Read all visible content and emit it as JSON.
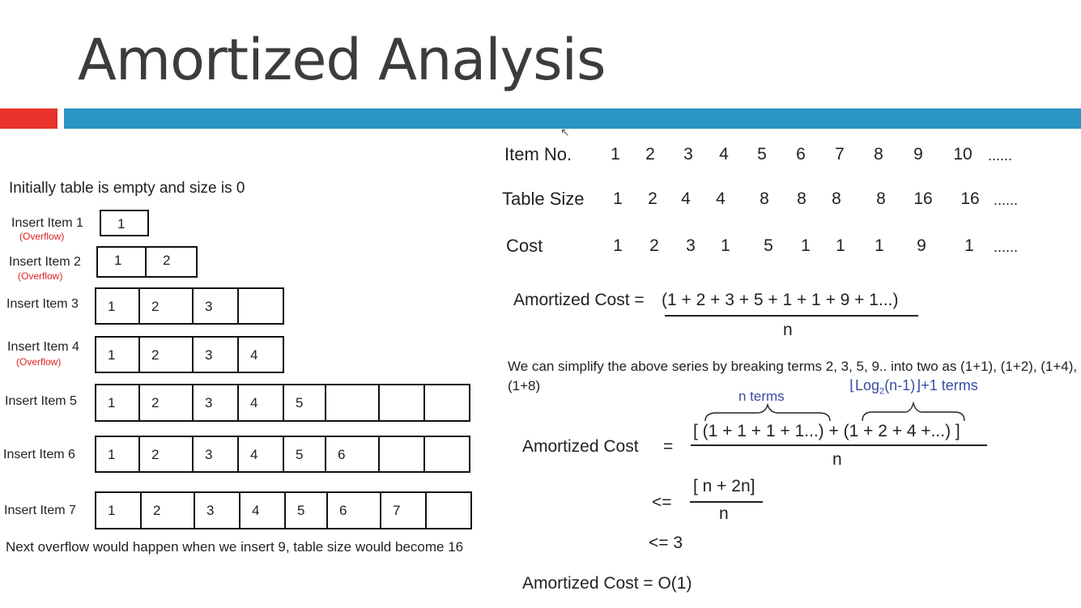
{
  "slide": {
    "title": "Amortized Analysis",
    "accent_red": "#e8332a",
    "accent_blue": "#2b95c3"
  },
  "left": {
    "intro": "Initially table is empty and size is 0",
    "inserts": [
      {
        "label": "Insert Item 1",
        "overflow": "(Overflow)",
        "cells": [
          "1"
        ]
      },
      {
        "label": "Insert Item 2",
        "overflow": "(Overflow)",
        "cells": [
          "1",
          "2"
        ]
      },
      {
        "label": "Insert Item 3",
        "overflow": "",
        "cells": [
          "1",
          "2",
          "3",
          ""
        ]
      },
      {
        "label": "Insert Item 4",
        "overflow": "(Overflow)",
        "cells": [
          "1",
          "2",
          "3",
          "4"
        ]
      },
      {
        "label": "Insert Item 5",
        "overflow": "",
        "cells": [
          "1",
          "2",
          "3",
          "4",
          "5",
          "",
          "",
          ""
        ]
      },
      {
        "label": "Insert Item 6",
        "overflow": "",
        "cells": [
          "1",
          "2",
          "3",
          "4",
          "5",
          "6",
          "",
          ""
        ]
      },
      {
        "label": "Insert Item 7",
        "overflow": "",
        "cells": [
          "1",
          "2",
          "3",
          "4",
          "5",
          "6",
          "7",
          ""
        ]
      }
    ],
    "note": "Next overflow would happen when we insert 9, table size would become 16"
  },
  "table": {
    "rows": [
      {
        "header": "Item No.",
        "values": [
          "1",
          "2",
          "3",
          "4",
          "5",
          "6",
          "7",
          "8",
          "9",
          "10"
        ],
        "trail": "......"
      },
      {
        "header": "Table Size",
        "values": [
          "1",
          "2",
          "4",
          "4",
          "8",
          "8",
          "8",
          "8",
          "16",
          "16"
        ],
        "trail": "......"
      },
      {
        "header": "Cost",
        "values": [
          "1",
          "2",
          "3",
          "1",
          "5",
          "1",
          "1",
          "1",
          "9",
          "1"
        ],
        "trail": "......"
      }
    ]
  },
  "math": {
    "eq1_lhs": "Amortized Cost = ",
    "eq1_num": "(1 + 2 + 3 + 5 + 1 + 1 + 9 + 1...)",
    "eq1_den": "n",
    "para": "We can simplify the above series by breaking terms 2, 3, 5, 9.. into two as (1+1), (1+2), (1+4), (1+8)",
    "n_terms": "n terms",
    "log_pre": "⌊Log",
    "log_sub": "2",
    "log_post": "(n-1)⌋+1 terms",
    "eq2_lhs": "Amortized Cost",
    "eq2_eq": "=",
    "eq2_num": "[ (1 + 1 + 1 + 1...) + (1 + 2 + 4  +...) ]",
    "eq2_den": "n",
    "le1": "<=",
    "le1_num": "[ n + 2n]",
    "le1_den": "n",
    "le2": "<=  3",
    "final": "Amortized Cost  =  O(1)"
  }
}
